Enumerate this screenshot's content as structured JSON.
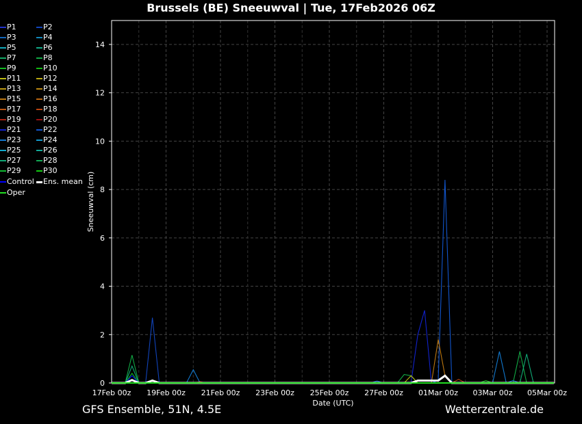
{
  "header": {
    "title": "Brussels  (BE)  Sneeuwval | Tue, 17Feb2026 06Z"
  },
  "footer": {
    "left": "GFS Ensemble, 51N, 4.5E",
    "right": "Wetterzentrale.de"
  },
  "legend": [
    {
      "label": "P1",
      "color": "#2233cc"
    },
    {
      "label": "P2",
      "color": "#1144bb"
    },
    {
      "label": "P3",
      "color": "#1166bb"
    },
    {
      "label": "P4",
      "color": "#1188bb"
    },
    {
      "label": "P5",
      "color": "#11aabb"
    },
    {
      "label": "P6",
      "color": "#11aa88"
    },
    {
      "label": "P7",
      "color": "#11aa66"
    },
    {
      "label": "P8",
      "color": "#11aa44"
    },
    {
      "label": "P9",
      "color": "#11bb22"
    },
    {
      "label": "P10",
      "color": "#11bb11"
    },
    {
      "label": "P11",
      "color": "#bbbb11"
    },
    {
      "label": "P12",
      "color": "#bbaa11"
    },
    {
      "label": "P13",
      "color": "#bb9911"
    },
    {
      "label": "P14",
      "color": "#bb8811"
    },
    {
      "label": "P15",
      "color": "#bb7711"
    },
    {
      "label": "P16",
      "color": "#bb6611"
    },
    {
      "label": "P17",
      "color": "#bb5511"
    },
    {
      "label": "P18",
      "color": "#bb4411"
    },
    {
      "label": "P19",
      "color": "#aa2211"
    },
    {
      "label": "P20",
      "color": "#991111"
    },
    {
      "label": "P21",
      "color": "#1122cc"
    },
    {
      "label": "P22",
      "color": "#1155cc"
    },
    {
      "label": "P23",
      "color": "#1177cc"
    },
    {
      "label": "P24",
      "color": "#1199cc"
    },
    {
      "label": "P25",
      "color": "#11aacc"
    },
    {
      "label": "P26",
      "color": "#11aa99"
    },
    {
      "label": "P27",
      "color": "#11aa77"
    },
    {
      "label": "P28",
      "color": "#11aa55"
    },
    {
      "label": "P29",
      "color": "#11bb33"
    },
    {
      "label": "P30",
      "color": "#11cc11"
    },
    {
      "label": "Control",
      "color": "#0000ff"
    },
    {
      "label": "Ens. mean",
      "color": "#ffffff"
    },
    {
      "label": "Oper",
      "color": "#22dd22"
    }
  ],
  "chart_data": {
    "type": "line",
    "title": "Brussels  (BE)  Sneeuwval | Tue, 17Feb2026 06Z",
    "xlabel": "Date (UTC)",
    "ylabel": "Sneeuwval (cm)",
    "xlim_hours": [
      0,
      390
    ],
    "ylim": [
      0,
      15
    ],
    "x_step_hours": 6,
    "xticks": [
      {
        "h": 0,
        "label": "17Feb 00z"
      },
      {
        "h": 48,
        "label": "19Feb 00z"
      },
      {
        "h": 96,
        "label": "21Feb 00z"
      },
      {
        "h": 144,
        "label": "23Feb 00z"
      },
      {
        "h": 192,
        "label": "25Feb 00z"
      },
      {
        "h": 240,
        "label": "27Feb 00z"
      },
      {
        "h": 288,
        "label": "01Mar 00z"
      },
      {
        "h": 336,
        "label": "03Mar 00z"
      },
      {
        "h": 384,
        "label": "05Mar 00z"
      }
    ],
    "yticks": [
      0,
      2,
      4,
      6,
      8,
      10,
      12,
      14
    ],
    "series": [
      {
        "name": "P2",
        "points": [
          [
            36,
            2.7
          ]
        ]
      },
      {
        "name": "P8",
        "points": [
          [
            18,
            1.15
          ],
          [
            258,
            0.35
          ],
          [
            264,
            0.3
          ],
          [
            360,
            1.3
          ]
        ]
      },
      {
        "name": "P27",
        "points": [
          [
            18,
            0.7
          ],
          [
            366,
            1.2
          ]
        ]
      },
      {
        "name": "P9",
        "points": [
          [
            18,
            0.4
          ],
          [
            330,
            0.1
          ]
        ]
      },
      {
        "name": "P23",
        "points": [
          [
            72,
            0.55
          ],
          [
            234,
            0.08
          ],
          [
            342,
            1.3
          ],
          [
            354,
            0.1
          ]
        ]
      },
      {
        "name": "P21",
        "points": [
          [
            270,
            2.0
          ],
          [
            276,
            3.0
          ]
        ]
      },
      {
        "name": "P22",
        "points": [
          [
            288,
            0.1
          ],
          [
            294,
            8.4
          ]
        ]
      },
      {
        "name": "P15",
        "points": [
          [
            288,
            1.8
          ],
          [
            294,
            0.3
          ]
        ]
      },
      {
        "name": "P11",
        "points": [
          [
            264,
            0.3
          ]
        ]
      },
      {
        "name": "P18",
        "points": [
          [
            306,
            0.15
          ],
          [
            78,
            0.05
          ]
        ]
      },
      {
        "name": "Control",
        "points": [
          [
            18,
            0.3
          ],
          [
            36,
            0.1
          ]
        ]
      },
      {
        "name": "Ens. mean",
        "points": [
          [
            18,
            0.12
          ],
          [
            36,
            0.1
          ],
          [
            270,
            0.1
          ],
          [
            276,
            0.1
          ],
          [
            282,
            0.1
          ],
          [
            288,
            0.1
          ],
          [
            294,
            0.3
          ]
        ]
      },
      {
        "name": "Oper",
        "points": []
      }
    ]
  }
}
